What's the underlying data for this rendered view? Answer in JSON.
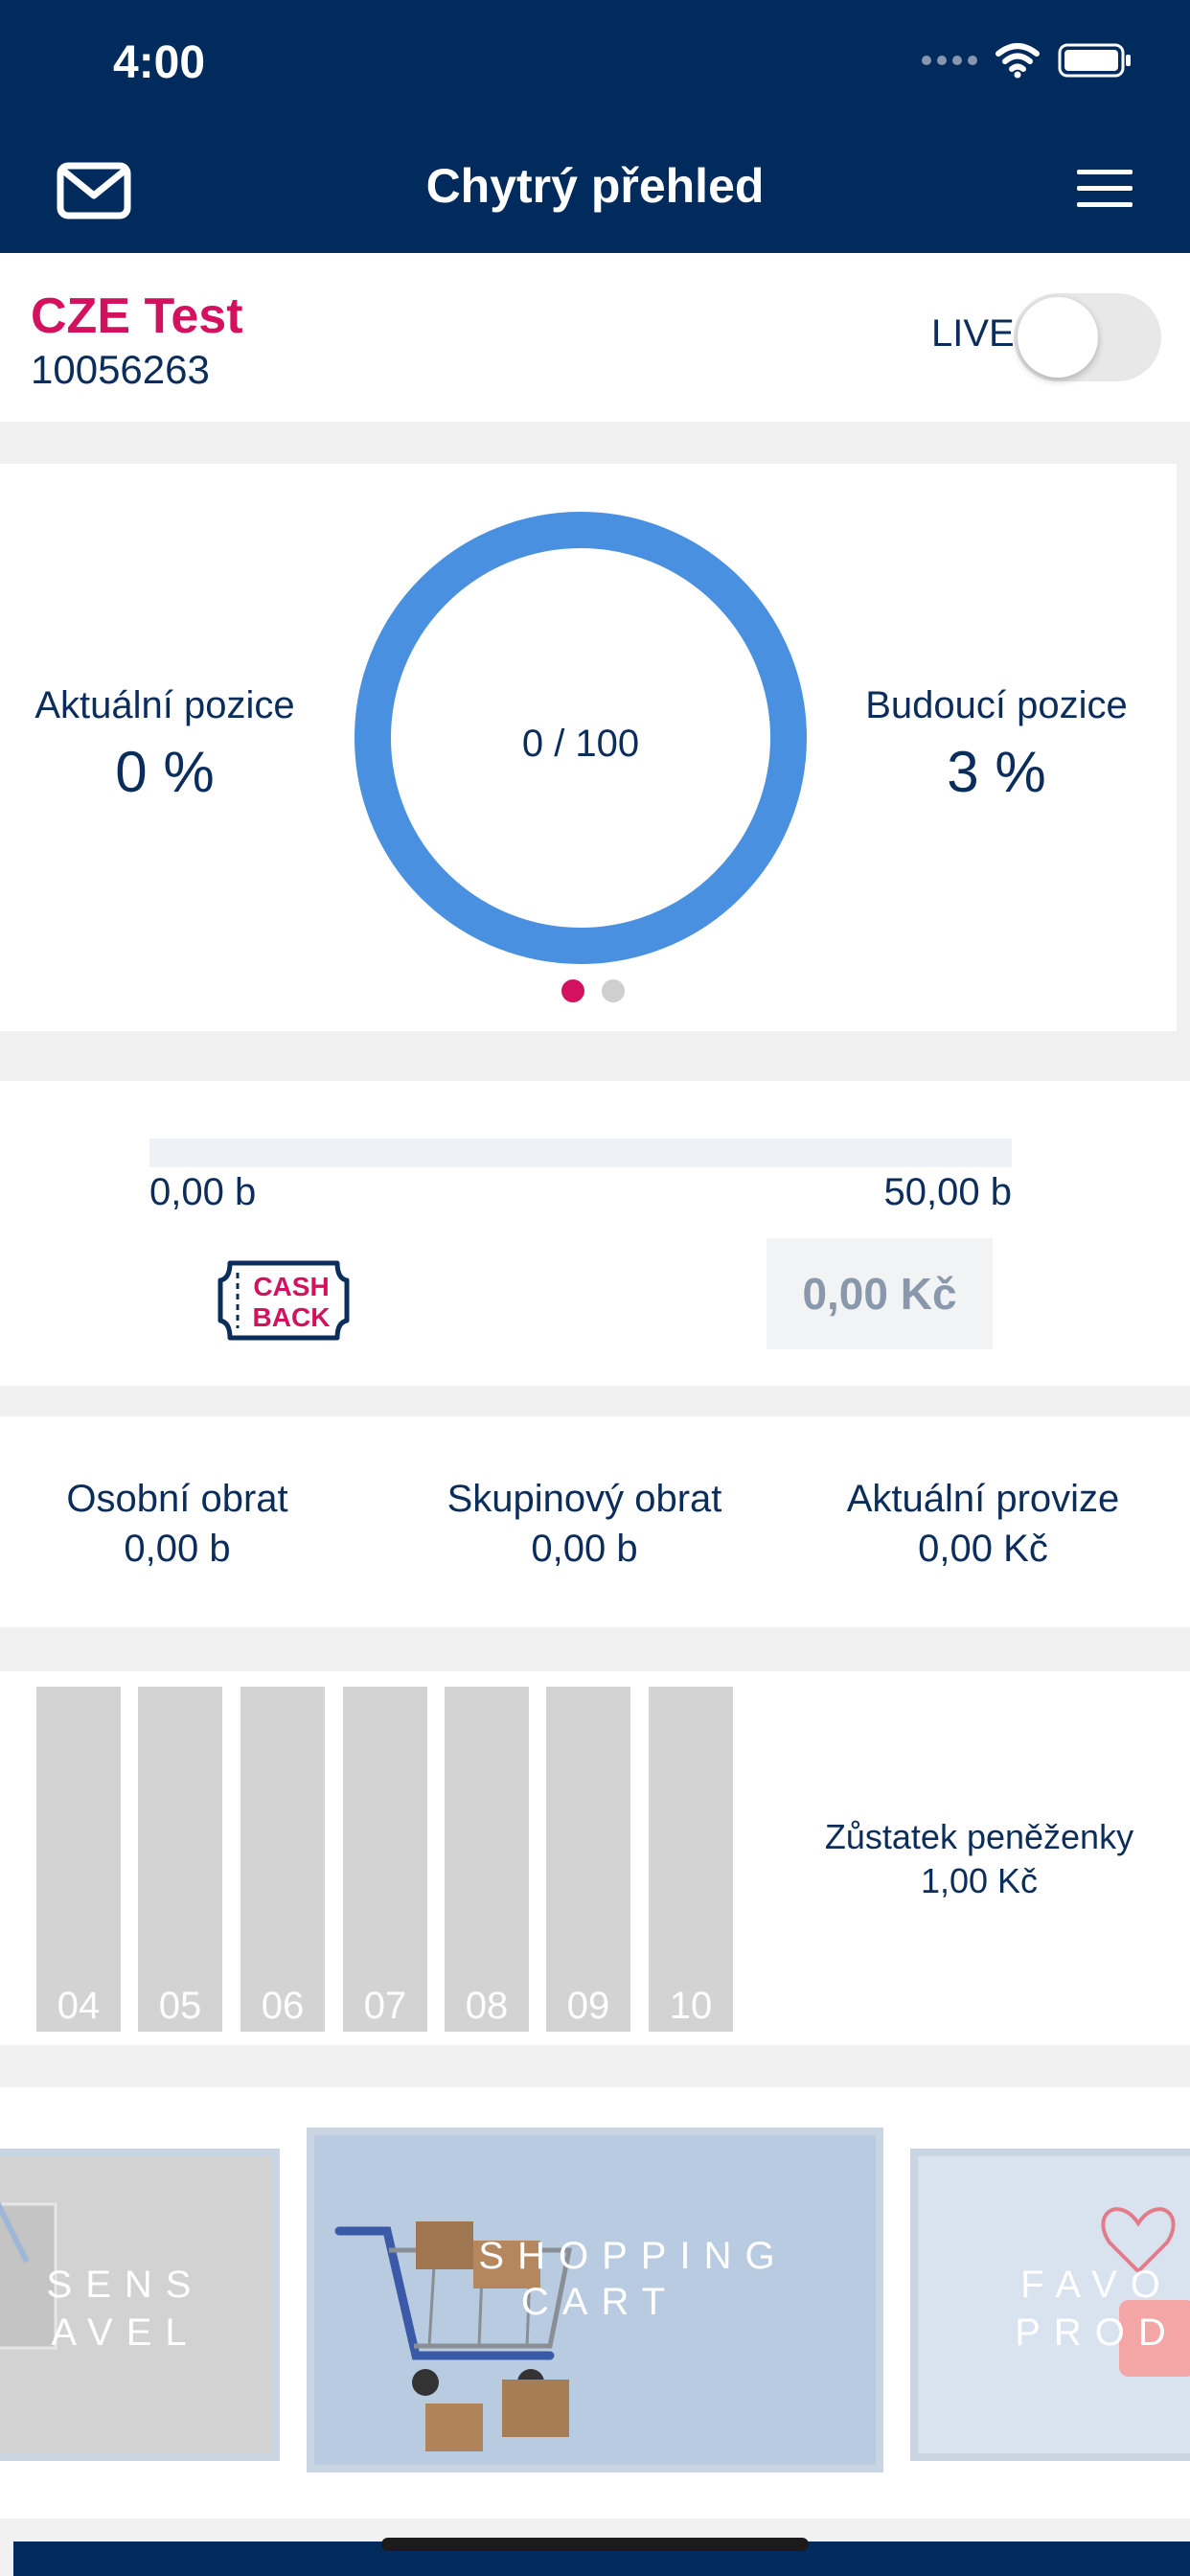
{
  "status_bar": {
    "time": "4:00"
  },
  "header": {
    "title": "Chytrý přehled",
    "left_icon": "mail-icon",
    "right_icon": "hamburger-menu-icon"
  },
  "account": {
    "name": "CZE Test",
    "id": "10056263",
    "live_label": "LIVE",
    "live_on": false
  },
  "position": {
    "current_label": "Aktuální pozice",
    "current_value": "0 %",
    "future_label": "Budoucí pozice",
    "future_value": "3 %",
    "ring_text": "0 / 100",
    "page_index": 0,
    "page_count": 2
  },
  "cashback": {
    "min_label": "0,00 b",
    "max_label": "50,00 b",
    "logo_line1": "CASH",
    "logo_line2": "BACK",
    "amount": "0,00 Kč"
  },
  "turnover": {
    "personal_label": "Osobní obrat",
    "personal_value": "0,00 b",
    "group_label": "Skupinový obrat",
    "group_value": "0,00 b",
    "commission_label": "Aktuální provize",
    "commission_value": "0,00 Kč"
  },
  "months": [
    "04",
    "05",
    "06",
    "07",
    "08",
    "09",
    "10"
  ],
  "wallet": {
    "label": "Zůstatek peněženky",
    "value": "1,00 Kč"
  },
  "banners": [
    {
      "line1": "SENS",
      "line2": "AVEL"
    },
    {
      "line1": "SHOPPING",
      "line2": "CART"
    },
    {
      "line1": "FAVO",
      "line2": "PROD"
    }
  ],
  "colors": {
    "navy": "#002b5c",
    "accent_pink": "#d4115f",
    "ring_blue": "#4a90e0"
  }
}
